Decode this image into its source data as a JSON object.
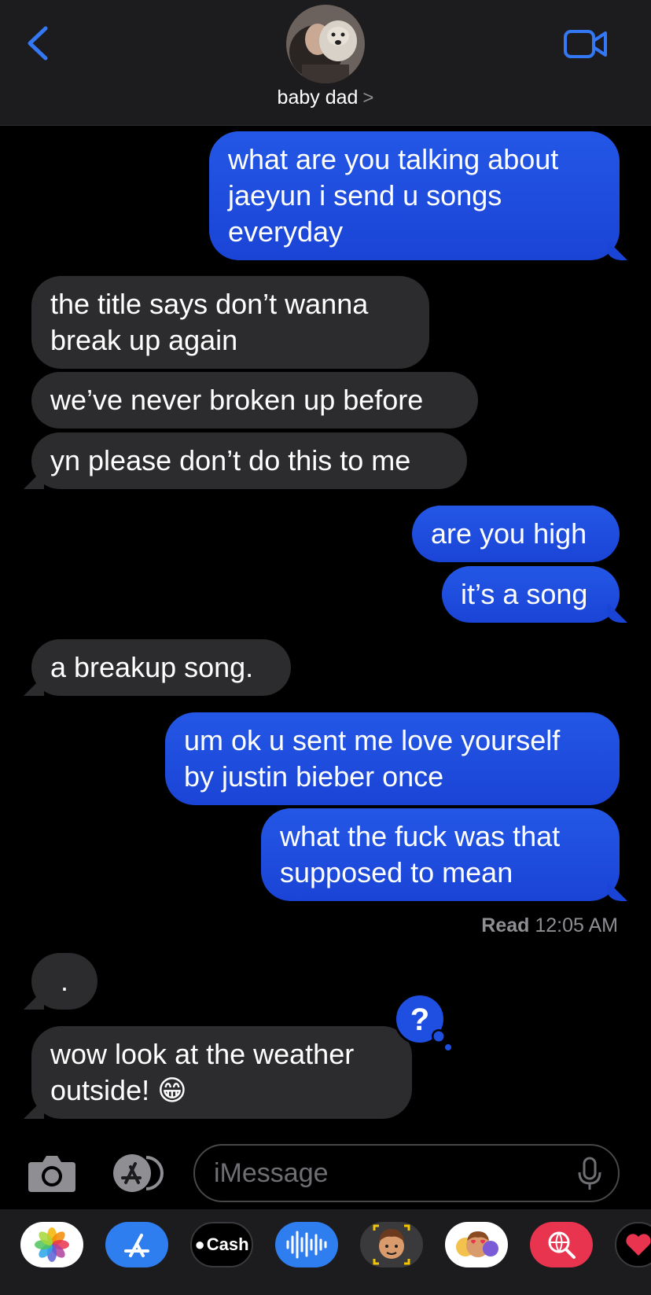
{
  "header": {
    "contact_name": "baby dad",
    "chevron": ">"
  },
  "messages": [
    {
      "id": "m1",
      "direction": "outgoing",
      "text_lines": [
        "what are you talking about",
        "jaeyun i send u songs",
        "everyday"
      ]
    },
    {
      "id": "m2",
      "direction": "incoming",
      "text_lines": [
        "the title says don’t wanna",
        "break up again"
      ]
    },
    {
      "id": "m3",
      "direction": "incoming",
      "text_lines": [
        "we’ve never broken up before"
      ]
    },
    {
      "id": "m4",
      "direction": "incoming",
      "text_lines": [
        "yn please don’t do this to me"
      ]
    },
    {
      "id": "m5",
      "direction": "outgoing",
      "text_lines": [
        "are you high"
      ]
    },
    {
      "id": "m6",
      "direction": "outgoing",
      "text_lines": [
        "it’s a song"
      ]
    },
    {
      "id": "m7",
      "direction": "incoming",
      "text_lines": [
        "a breakup song."
      ]
    },
    {
      "id": "m8",
      "direction": "outgoing",
      "text_lines": [
        "um ok u sent me love yourself",
        "by justin bieber once"
      ]
    },
    {
      "id": "m9",
      "direction": "outgoing",
      "text_lines": [
        "what the fuck was that",
        "supposed to mean"
      ]
    },
    {
      "id": "m10",
      "direction": "incoming",
      "text_lines": [
        "."
      ]
    },
    {
      "id": "m11",
      "direction": "incoming",
      "text_lines": [
        "wow look at the weather",
        "outside! 😁"
      ]
    }
  ],
  "read_receipt": {
    "label": "Read",
    "time": "12:05 AM"
  },
  "reaction": {
    "symbol": "?",
    "icon": "question-mark-tapback"
  },
  "composer": {
    "placeholder": "iMessage"
  },
  "app_drawer": {
    "cash_label": "Cash",
    "apps": [
      "photos",
      "app-store",
      "apple-cash",
      "audio-message",
      "memoji",
      "animoji-stickers",
      "image-search",
      "digital-touch"
    ]
  },
  "colors": {
    "outgoing_bubble": "#1f4fe0",
    "incoming_bubble": "#2c2c2e",
    "accent": "#3478f6",
    "background": "#000000"
  }
}
